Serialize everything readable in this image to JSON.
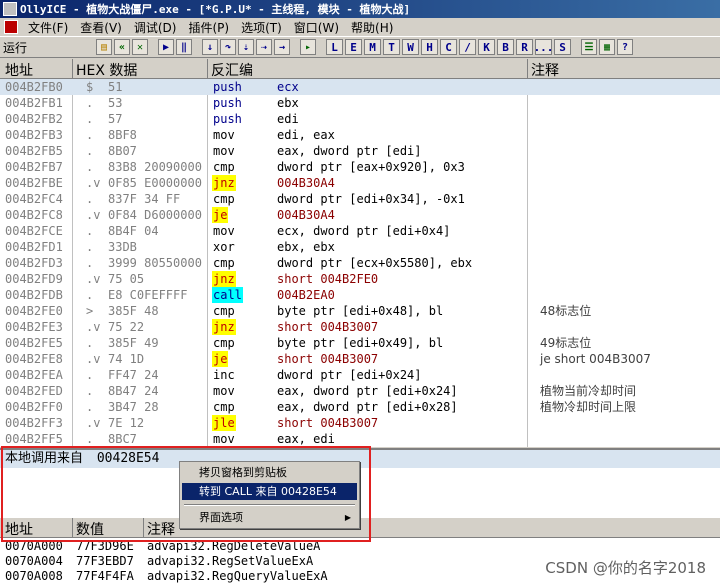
{
  "window": {
    "title": "OllyICE - 植物大战僵尸.exe - [*G.P.U* - 主线程, 模块 - 植物大战]"
  },
  "menu": [
    "文件(F)",
    "查看(V)",
    "调试(D)",
    "插件(P)",
    "选项(T)",
    "窗口(W)",
    "帮助(H)"
  ],
  "toolbar": {
    "status": "运行",
    "letters": [
      "L",
      "E",
      "M",
      "T",
      "W",
      "H",
      "C",
      "/",
      "K",
      "B",
      "R",
      "...",
      "S"
    ]
  },
  "disasm": {
    "headers": {
      "addr": "地址",
      "hex": "HEX 数据",
      "asm": "反汇编",
      "comment": "注释"
    },
    "rows": [
      {
        "addr": "004B2FB0",
        "mark": "$",
        "hex": "51",
        "mn": "push",
        "op": "ecx",
        "cm": "",
        "mnStyle": "blue",
        "opStyle": "blue"
      },
      {
        "addr": "004B2FB1",
        "mark": ".",
        "hex": "53",
        "mn": "push",
        "op": "ebx",
        "cm": "",
        "mnStyle": "blue",
        "opStyle": ""
      },
      {
        "addr": "004B2FB2",
        "mark": ".",
        "hex": "57",
        "mn": "push",
        "op": "edi",
        "cm": "",
        "mnStyle": "blue",
        "opStyle": ""
      },
      {
        "addr": "004B2FB3",
        "mark": ".",
        "hex": "8BF8",
        "mn": "mov",
        "op": "edi, eax",
        "cm": "",
        "mnStyle": "",
        "opStyle": ""
      },
      {
        "addr": "004B2FB5",
        "mark": ".",
        "hex": "8B07",
        "mn": "mov",
        "op": "eax, dword ptr [edi]",
        "cm": "",
        "mnStyle": "",
        "opStyle": ""
      },
      {
        "addr": "004B2FB7",
        "mark": ".",
        "hex": "83B8 20090000",
        "mn": "cmp",
        "op": "dword ptr [eax+0x920], 0x3",
        "cm": "",
        "mnStyle": "",
        "opStyle": ""
      },
      {
        "addr": "004B2FBE",
        "mark": ".v",
        "hex": "0F85 E0000000",
        "mn": "jnz",
        "op": "004B30A4",
        "cm": "",
        "mnStyle": "jcc",
        "opStyle": "red"
      },
      {
        "addr": "004B2FC4",
        "mark": ".",
        "hex": "837F 34 FF",
        "mn": "cmp",
        "op": "dword ptr [edi+0x34], -0x1",
        "cm": "",
        "mnStyle": "",
        "opStyle": ""
      },
      {
        "addr": "004B2FC8",
        "mark": ".v",
        "hex": "0F84 D6000000",
        "mn": "je",
        "op": "004B30A4",
        "cm": "",
        "mnStyle": "jcc",
        "opStyle": "red"
      },
      {
        "addr": "004B2FCE",
        "mark": ".",
        "hex": "8B4F 04",
        "mn": "mov",
        "op": "ecx, dword ptr [edi+0x4]",
        "cm": "",
        "mnStyle": "",
        "opStyle": ""
      },
      {
        "addr": "004B2FD1",
        "mark": ".",
        "hex": "33DB",
        "mn": "xor",
        "op": "ebx, ebx",
        "cm": "",
        "mnStyle": "",
        "opStyle": ""
      },
      {
        "addr": "004B2FD3",
        "mark": ".",
        "hex": "3999 80550000",
        "mn": "cmp",
        "op": "dword ptr [ecx+0x5580], ebx",
        "cm": "",
        "mnStyle": "",
        "opStyle": ""
      },
      {
        "addr": "004B2FD9",
        "mark": ".v",
        "hex": "75 05",
        "mn": "jnz",
        "op": "short 004B2FE0",
        "cm": "",
        "mnStyle": "jcc",
        "opStyle": "red"
      },
      {
        "addr": "004B2FDB",
        "mark": ".",
        "hex": "E8 C0FEFFFF",
        "mn": "call",
        "op": "004B2EA0",
        "cm": "",
        "mnStyle": "call",
        "opStyle": "red"
      },
      {
        "addr": "004B2FE0",
        "mark": ">",
        "hex": "385F 48",
        "mn": "cmp",
        "op": "byte ptr [edi+0x48], bl",
        "cm": "48标志位",
        "mnStyle": "",
        "opStyle": ""
      },
      {
        "addr": "004B2FE3",
        "mark": ".v",
        "hex": "75 22",
        "mn": "jnz",
        "op": "short 004B3007",
        "cm": "",
        "mnStyle": "jcc",
        "opStyle": "red"
      },
      {
        "addr": "004B2FE5",
        "mark": ".",
        "hex": "385F 49",
        "mn": "cmp",
        "op": "byte ptr [edi+0x49], bl",
        "cm": "49标志位",
        "mnStyle": "",
        "opStyle": ""
      },
      {
        "addr": "004B2FE8",
        "mark": ".v",
        "hex": "74 1D",
        "mn": "je",
        "op": "short 004B3007",
        "cm": "je        short 004B3007",
        "mnStyle": "jcc",
        "opStyle": "red"
      },
      {
        "addr": "004B2FEA",
        "mark": ".",
        "hex": "FF47 24",
        "mn": "inc",
        "op": "dword ptr [edi+0x24]",
        "cm": "",
        "mnStyle": "",
        "opStyle": ""
      },
      {
        "addr": "004B2FED",
        "mark": ".",
        "hex": "8B47 24",
        "mn": "mov",
        "op": "eax, dword ptr [edi+0x24]",
        "cm": "植物当前冷却时间",
        "mnStyle": "",
        "opStyle": ""
      },
      {
        "addr": "004B2FF0",
        "mark": ".",
        "hex": "3B47 28",
        "mn": "cmp",
        "op": "eax, dword ptr [edi+0x28]",
        "cm": "植物冷却时间上限",
        "mnStyle": "",
        "opStyle": ""
      },
      {
        "addr": "004B2FF3",
        "mark": ".v",
        "hex": "7E 12",
        "mn": "jle",
        "op": "short 004B3007",
        "cm": "",
        "mnStyle": "jcc",
        "opStyle": "red"
      },
      {
        "addr": "004B2FF5",
        "mark": ".",
        "hex": "8BC7",
        "mn": "mov",
        "op": "eax, edi",
        "cm": "",
        "mnStyle": "",
        "opStyle": ""
      }
    ]
  },
  "info": {
    "label": "本地调用来自",
    "value": "00428E54"
  },
  "context_menu": {
    "items": [
      "拷贝窗格到剪贴板",
      "转到 CALL 来自 00428E54",
      "界面选项"
    ],
    "highlighted_index": 1
  },
  "dump": {
    "headers": {
      "addr": "地址",
      "value": "数值",
      "comment": "注释"
    },
    "rows": [
      {
        "addr": "0070A000",
        "value": "77F3D96E",
        "comment": "advapi32.RegDeleteValueA"
      },
      {
        "addr": "0070A004",
        "value": "77F3EBD7",
        "comment": "advapi32.RegSetValueExA"
      },
      {
        "addr": "0070A008",
        "value": "77F4F4FA",
        "comment": "advapi32.RegQueryValueExA"
      }
    ]
  },
  "watermark": "CSDN @你的名字2018"
}
